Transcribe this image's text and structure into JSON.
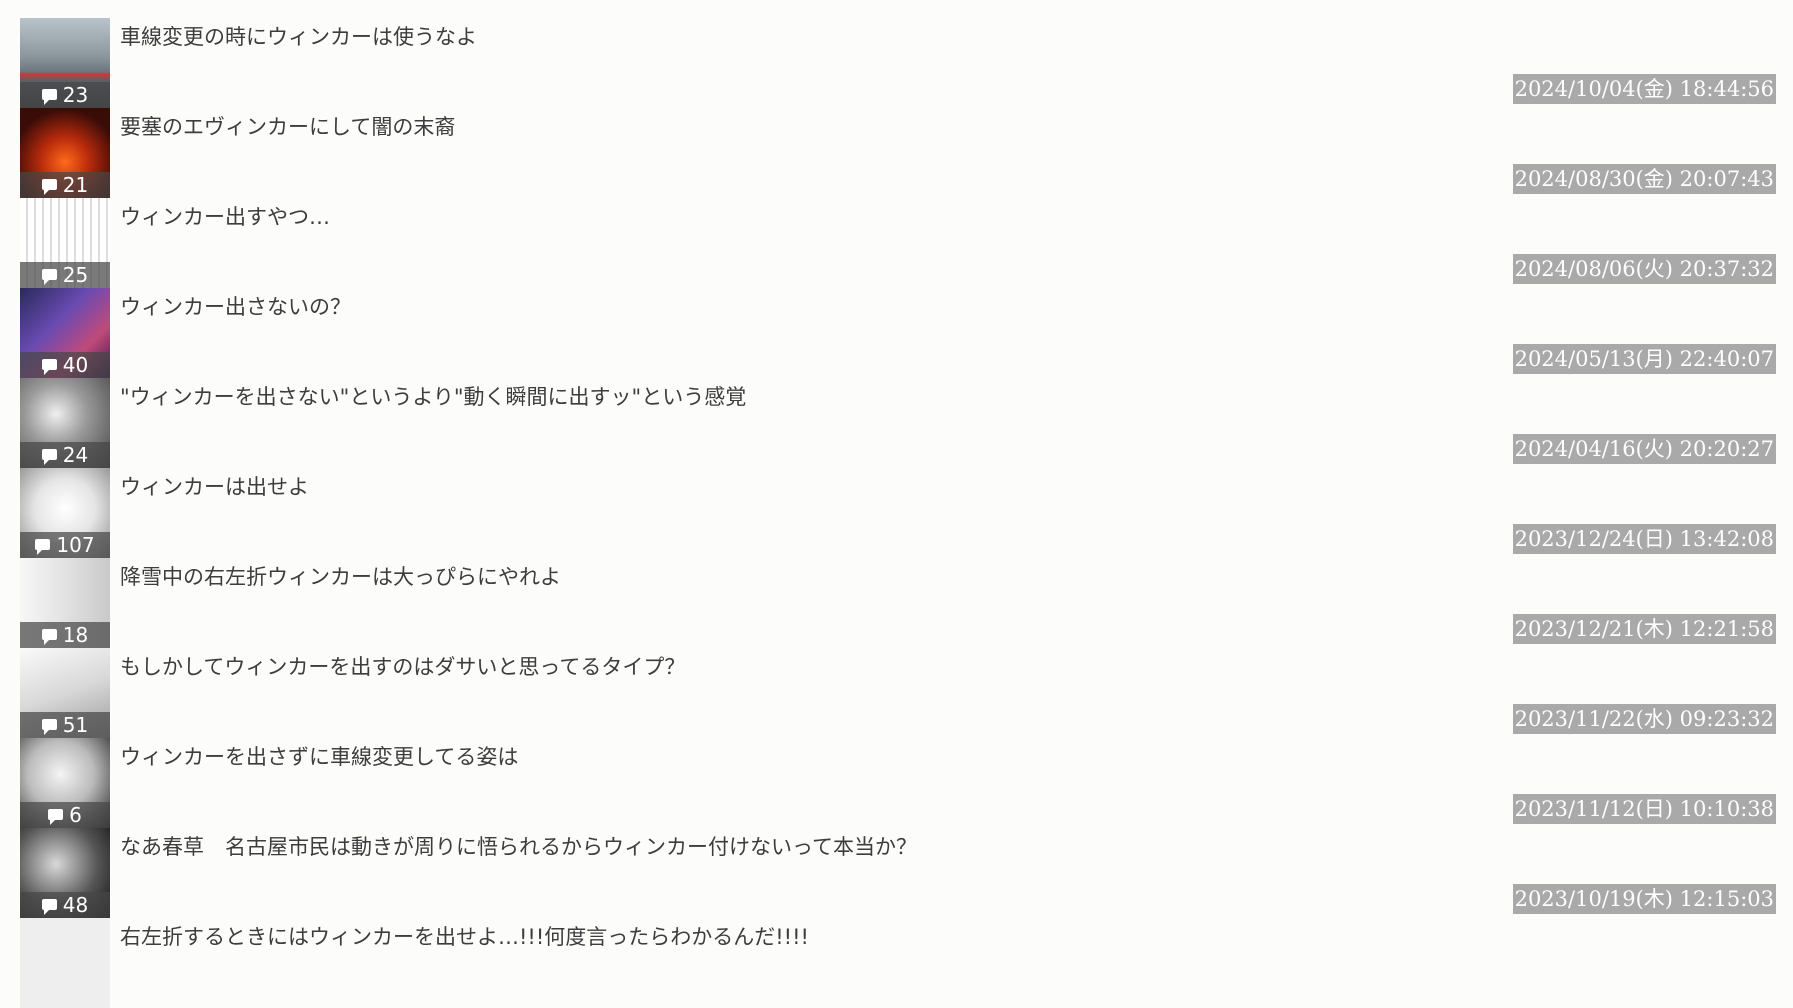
{
  "threads": [
    {
      "title": "車線変更の時にウィンカーは使うなよ",
      "count": "23",
      "date": "2024/10/04(金) 18:44:56",
      "thumb": "t0"
    },
    {
      "title": "要塞のエヴィンカーにして闇の末裔",
      "count": "21",
      "date": "2024/08/30(金) 20:07:43",
      "thumb": "t1"
    },
    {
      "title": "ウィンカー出すやつ…",
      "count": "25",
      "date": "2024/08/06(火) 20:37:32",
      "thumb": "t2"
    },
    {
      "title": "ウィンカー出さないの？",
      "count": "40",
      "date": "2024/05/13(月) 22:40:07",
      "thumb": "t3"
    },
    {
      "title": "\"ウィンカーを出さない\"というより\"動く瞬間に出すッ\"という感覚",
      "count": "24",
      "date": "2024/04/16(火) 20:20:27",
      "thumb": "t4"
    },
    {
      "title": "ウィンカーは出せよ",
      "count": "107",
      "date": "2023/12/24(日) 13:42:08",
      "thumb": "t5"
    },
    {
      "title": "降雪中の右左折ウィンカーは大っぴらにやれよ",
      "count": "18",
      "date": "2023/12/21(木) 12:21:58",
      "thumb": "t6"
    },
    {
      "title": "もしかしてウィンカーを出すのはダサいと思ってるタイプ？",
      "count": "51",
      "date": "2023/11/22(水) 09:23:32",
      "thumb": "t7"
    },
    {
      "title": "ウィンカーを出さずに車線変更してる姿は",
      "count": "6",
      "date": "2023/11/12(日) 10:10:38",
      "thumb": "t8"
    },
    {
      "title": "なあ春草　名古屋市民は動きが周りに悟られるからウィンカー付けないって本当か？",
      "count": "48",
      "date": "2023/10/19(木) 12:15:03",
      "thumb": "t9"
    },
    {
      "title": "右左折するときにはウィンカーを出せよ…!!!何度言ったらわかるんだ!!!!",
      "count": "",
      "date": "",
      "thumb": "t10"
    }
  ]
}
